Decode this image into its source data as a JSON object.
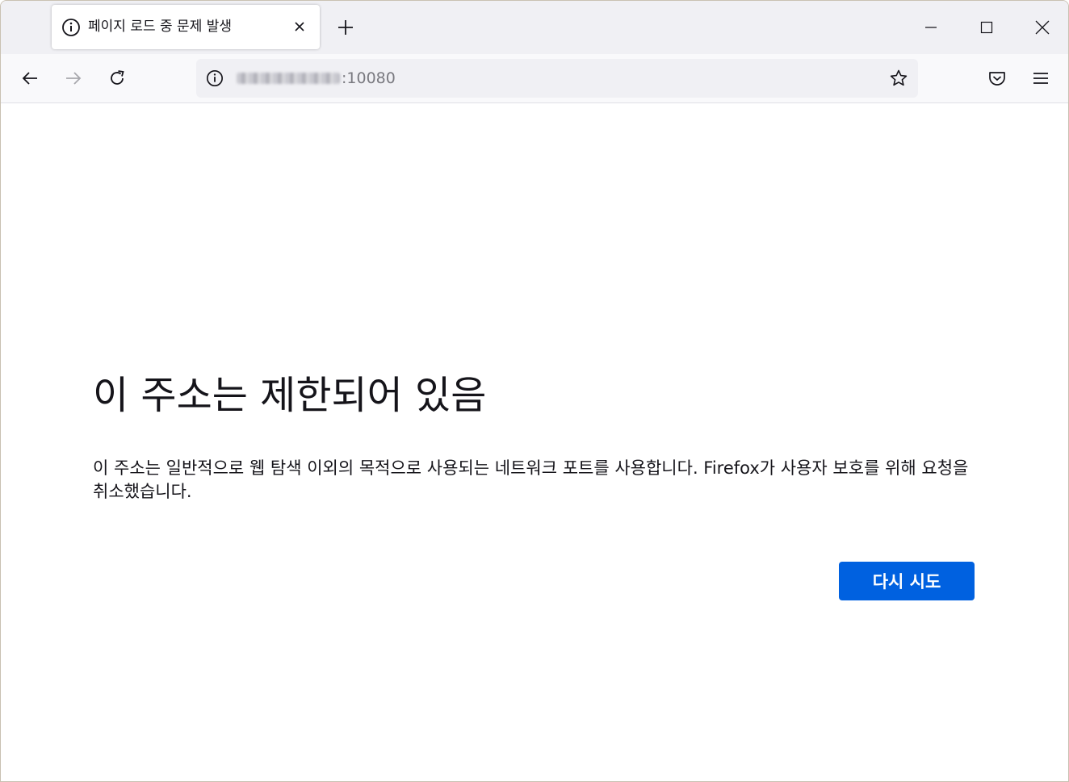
{
  "tab": {
    "title": "페이지 로드 중 문제 발생",
    "icon": "info-icon",
    "close_icon": "close-icon"
  },
  "window_controls": [
    "minimize-icon",
    "maximize-icon",
    "close-icon"
  ],
  "navbar": {
    "url_visible": ":10080",
    "url_obscured": true,
    "buttons": [
      "back-arrow-icon",
      "forward-arrow-icon",
      "reload-icon",
      "bookmark-star-icon",
      "pocket-icon",
      "hamburger-menu-icon"
    ]
  },
  "error": {
    "title": "이 주소는 제한되어 있음",
    "description": "이 주소는 일반적으로 웹 탐색 이외의 목적으로 사용되는 네트워크 포트를 사용합니다. Firefox가 사용자 보호를 위해 요청을 취소했습니다.",
    "retry_label": "다시 시도"
  },
  "colors": {
    "accent": "#0061e0",
    "tabstrip_bg": "#f0f0f4",
    "toolbar_bg": "#f9f9fb",
    "text": "#15141a"
  }
}
